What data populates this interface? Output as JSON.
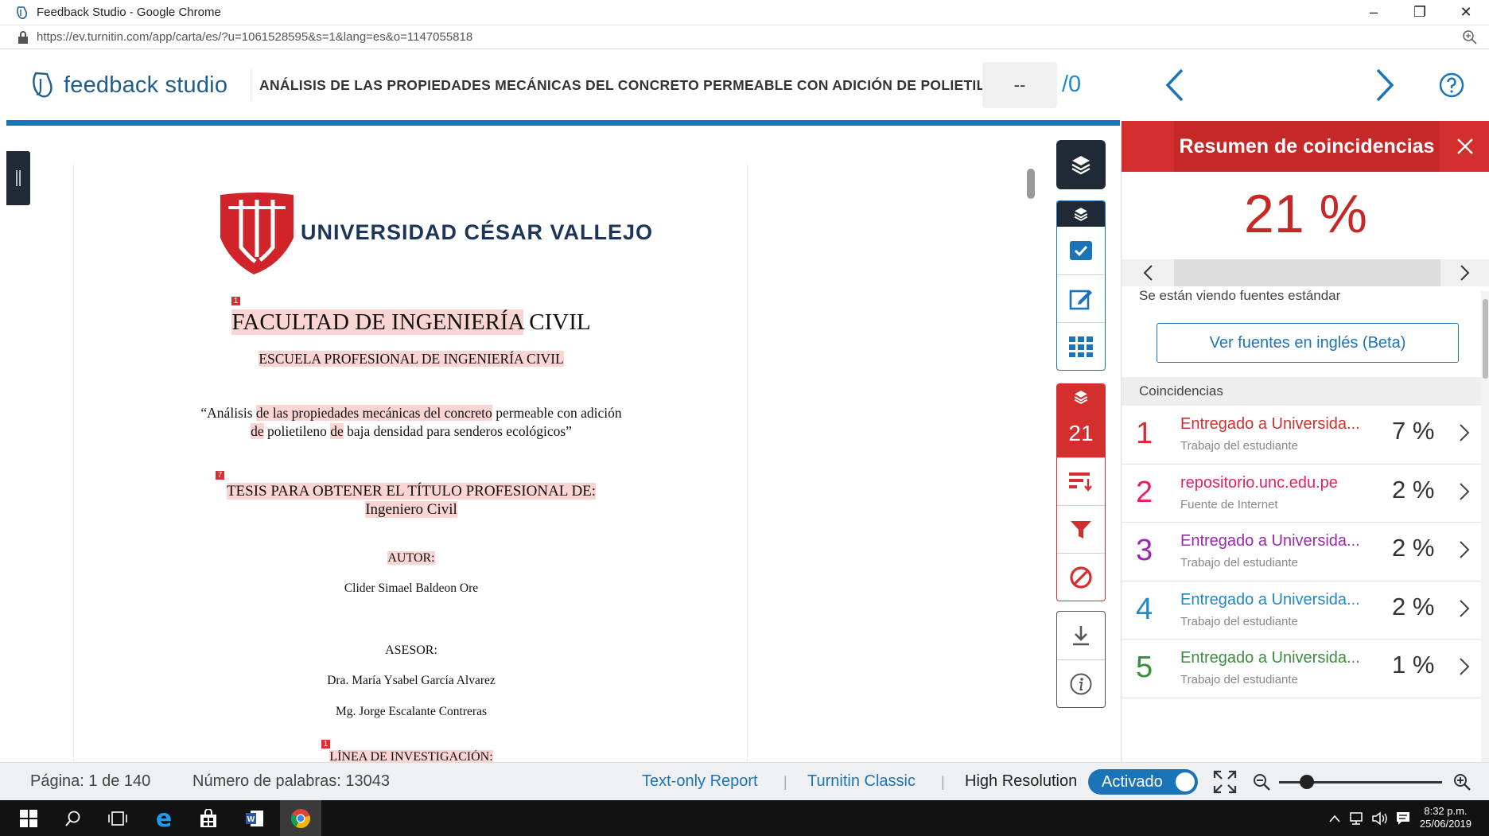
{
  "browser": {
    "window_title": "Feedback Studio - Google Chrome",
    "url": "https://ev.turnitin.com/app/carta/es/?u=1061528595&s=1&lang=es&o=1147055818"
  },
  "header": {
    "logo_text": "feedback studio",
    "doc_title": "ANÁLISIS DE LAS PROPIEDADES MECÁNICAS DEL CONCRETO PERMEABLE CON ADICIÓN DE POLIETILE",
    "grade_value": "--",
    "grade_max": "/0"
  },
  "document": {
    "university": "UNIVERSIDAD CÉSAR VALLEJO",
    "faculty_hl": "FACULTAD DE INGENIERÍA",
    "faculty_rest": " CIVIL",
    "school": "ESCUELA PROFESIONAL DE INGENIERÍA CIVIL",
    "title_a": "“Análisis ",
    "title_b": "de las propiedades mecánicas del concreto",
    "title_c": " permeable con adición",
    "title_d": "de",
    "title_e": " polietileno ",
    "title_f": "de",
    "title_g": " baja densidad para senderos ecológicos”",
    "thesis_line1": "TESIS PARA OBTENER EL TÍTULO PROFESIONAL DE:",
    "thesis_line2": "Ingeniero Civil",
    "author_label": "AUTOR:",
    "author_name": "Clider Simael Baldeon Ore",
    "advisor_label": "ASESOR:",
    "advisor_1": "Dra. María Ysabel García Alvarez",
    "advisor_2": "Mg. Jorge Escalante Contreras",
    "research_line": "LÍNEA DE INVESTIGACIÓN:",
    "marker_1": "1",
    "marker_7": "7",
    "marker_1b": "1"
  },
  "tools": {
    "match_count": "21"
  },
  "panel": {
    "title": "Resumen de coincidencias",
    "percent": "21 %",
    "viewing_text": "Se están viendo fuentes estándar",
    "english_button": "Ver fuentes en inglés (Beta)",
    "matches_header": "Coincidencias",
    "matches": [
      {
        "num": "1",
        "title": "Entregado a Universida...",
        "sub": "Trabajo del estudiante",
        "pct": "7 %",
        "color": "#d32f2f"
      },
      {
        "num": "2",
        "title": "repositorio.unc.edu.pe",
        "sub": "Fuente de Internet",
        "pct": "2 %",
        "color": "#e91e63"
      },
      {
        "num": "3",
        "title": "Entregado a Universida...",
        "sub": "Trabajo del estudiante",
        "pct": "2 %",
        "color": "#9c27b0"
      },
      {
        "num": "4",
        "title": "Entregado a Universida...",
        "sub": "Trabajo del estudiante",
        "pct": "2 %",
        "color": "#1e88c9"
      },
      {
        "num": "5",
        "title": "Entregado a Universida...",
        "sub": "Trabajo del estudiante",
        "pct": "1 %",
        "color": "#388e3c"
      }
    ]
  },
  "status": {
    "page": "Página: 1 de 140",
    "words": "Número de palabras: 13043",
    "text_only": "Text-only Report",
    "classic": "Turnitin Classic",
    "hires": "High Resolution",
    "toggle": "Activado"
  },
  "taskbar": {
    "time": "8:32 p.m.",
    "date": "25/06/2019"
  },
  "colors": {
    "brand_blue": "#1b74b8",
    "match_red": "#d32f2f",
    "highlight": "#fbd4d4"
  }
}
